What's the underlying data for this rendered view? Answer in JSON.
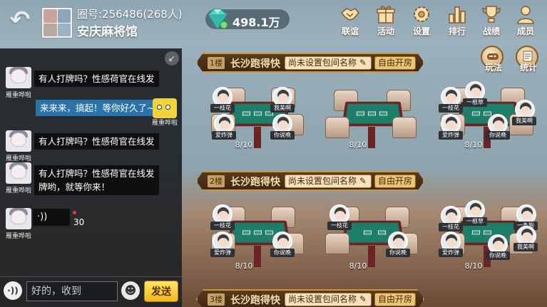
{
  "header": {
    "back_icon": "back-arrow-icon",
    "club_id": "圈号:256486(268人)",
    "club_name": "安庆麻将馆",
    "diamonds": "498.1万",
    "menu": [
      {
        "label": "联谊",
        "icon": "handshake-icon"
      },
      {
        "label": "活动",
        "icon": "gift-icon"
      },
      {
        "label": "设置",
        "icon": "gear-icon"
      },
      {
        "label": "排行",
        "icon": "ranking-icon"
      },
      {
        "label": "战绩",
        "icon": "trophy-icon"
      },
      {
        "label": "成员",
        "icon": "members-icon"
      }
    ]
  },
  "side_buttons": {
    "rules_label": "玩法",
    "stats_label": "统计"
  },
  "chat": {
    "messages": [
      {
        "nick": "雁重哗啦",
        "text": "有人打牌吗？性感荷官在线发"
      },
      {
        "nick": "雁重哗啦",
        "text": "来来来，搞起！等你好久了~",
        "self": true
      },
      {
        "nick": "雁重哗啦",
        "text": "有人打牌吗？性感荷官在线发"
      },
      {
        "nick": "雁重哗啦",
        "text_line1": "有人打牌吗？性感荷官在线发",
        "text_line2": "牌哟，就等你来！"
      },
      {
        "nick": "雁重哗啦",
        "voice_icon": "·))",
        "duration": "30"
      }
    ],
    "input_placeholder": "好的，收到",
    "send_label": "发送",
    "voice_label": "·))",
    "emoji_icon": "smiley-icon"
  },
  "floors": [
    {
      "tag": "1楼",
      "title": "长沙跑得快",
      "room_name": "尚未设置包间名称",
      "open_label": "自由开房",
      "tables": [
        {
          "seats": "8/10",
          "players": [
            "一枝花",
            "我美啊",
            "爱炸弹",
            "你说晚"
          ]
        },
        {
          "seats": "8/10",
          "players": []
        },
        {
          "seats": "8/10",
          "players": [
            "一枝花",
            "一根草",
            "爱炸弹",
            "你说晚",
            "我美啊"
          ]
        }
      ]
    },
    {
      "tag": "2楼",
      "title": "长沙跑得快",
      "room_name": "尚未设置包间名称",
      "open_label": "自由开房",
      "tables": [
        {
          "seats": "8/10",
          "players": [
            "一枝花",
            "爱炸弹",
            "你说晚"
          ]
        },
        {
          "seats": "8/10",
          "players": [
            "一枝花",
            "你说晚"
          ]
        },
        {
          "seats": "8/10",
          "players": [
            "一枝花",
            "一根草",
            "一条狗",
            "爱炸弹",
            "你说晚",
            "我美啊"
          ]
        }
      ]
    },
    {
      "tag": "3楼",
      "title": "长沙跑得快",
      "room_name": "尚未设置包间名称",
      "open_label": "自由开房"
    }
  ],
  "colors": {
    "banner_border": "#c9973f",
    "table_felt": "#1f7e6a",
    "send_button": "#f2b91d"
  }
}
